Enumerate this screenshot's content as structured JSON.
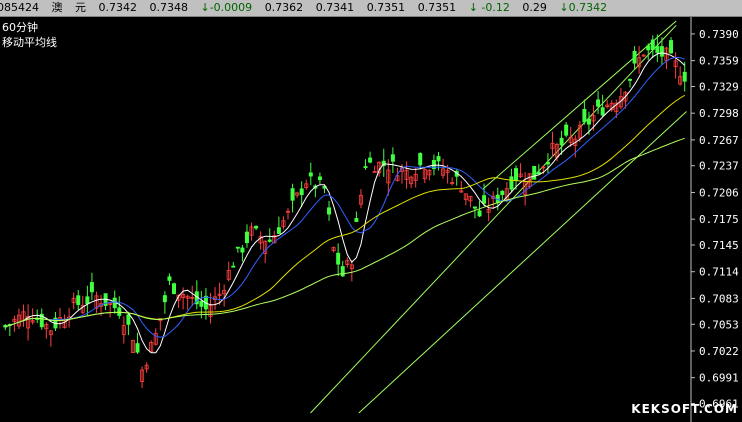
{
  "quote_bar": {
    "code": "085424",
    "name": "澳",
    "unit": "元",
    "open": "0.7342",
    "prev": "0.7348",
    "change": "↓-0.0009",
    "high": "0.7362",
    "low": "0.7341",
    "v1": "0.7351",
    "v2": "0.7351",
    "pct": "↓ -0.12",
    "amp": "0.29",
    "last": "↓0.7342"
  },
  "legend": {
    "period": "60分钟",
    "indicator": "移动平均线"
  },
  "watermark": "KEKSOFT.COM",
  "colors": {
    "background": "#000000",
    "up_bar": "#ff4040",
    "down_bar": "#40ff40",
    "ma_white": "#ffffff",
    "ma_yellow": "#e0e000",
    "ma_blue": "#3060ff",
    "ma_green": "#b0ff60",
    "channel": "#a0ff60",
    "axis_text": "#ffffff"
  },
  "chart_data": {
    "type": "candlestick",
    "y_axis_position": "right",
    "ylim": [
      0.695,
      0.7405
    ],
    "yticks": [
      "0.7390",
      "0.7359",
      "0.7329",
      "0.7298",
      "0.7267",
      "0.7237",
      "0.7206",
      "0.7175",
      "0.7145",
      "0.7114",
      "0.7083",
      "0.7053",
      "0.7022",
      "0.6991",
      "0.6961"
    ],
    "bar_count": 150,
    "close_path": [
      [
        0,
        0.705
      ],
      [
        5,
        0.7068
      ],
      [
        10,
        0.7048
      ],
      [
        15,
        0.7075
      ],
      [
        20,
        0.7085
      ],
      [
        25,
        0.707
      ],
      [
        28,
        0.704
      ],
      [
        30,
        0.7
      ],
      [
        33,
        0.704
      ],
      [
        36,
        0.71
      ],
      [
        40,
        0.7085
      ],
      [
        44,
        0.707
      ],
      [
        47,
        0.7088
      ],
      [
        50,
        0.7125
      ],
      [
        54,
        0.716
      ],
      [
        58,
        0.715
      ],
      [
        62,
        0.718
      ],
      [
        66,
        0.722
      ],
      [
        70,
        0.721
      ],
      [
        72,
        0.714
      ],
      [
        74,
        0.711
      ],
      [
        76,
        0.713
      ],
      [
        79,
        0.724
      ],
      [
        84,
        0.7238
      ],
      [
        88,
        0.723
      ],
      [
        92,
        0.724
      ],
      [
        96,
        0.7234
      ],
      [
        100,
        0.7215
      ],
      [
        104,
        0.718
      ],
      [
        108,
        0.72
      ],
      [
        112,
        0.7225
      ],
      [
        116,
        0.7225
      ],
      [
        120,
        0.7255
      ],
      [
        125,
        0.727
      ],
      [
        130,
        0.73
      ],
      [
        135,
        0.732
      ],
      [
        140,
        0.737
      ],
      [
        145,
        0.7365
      ],
      [
        149,
        0.7342
      ]
    ],
    "moving_averages": [
      {
        "color_key": "ma_white",
        "window": 5
      },
      {
        "color_key": "ma_blue",
        "window": 10
      },
      {
        "color_key": "ma_yellow",
        "window": 30
      },
      {
        "color_key": "ma_green",
        "window": 60
      }
    ]
  }
}
